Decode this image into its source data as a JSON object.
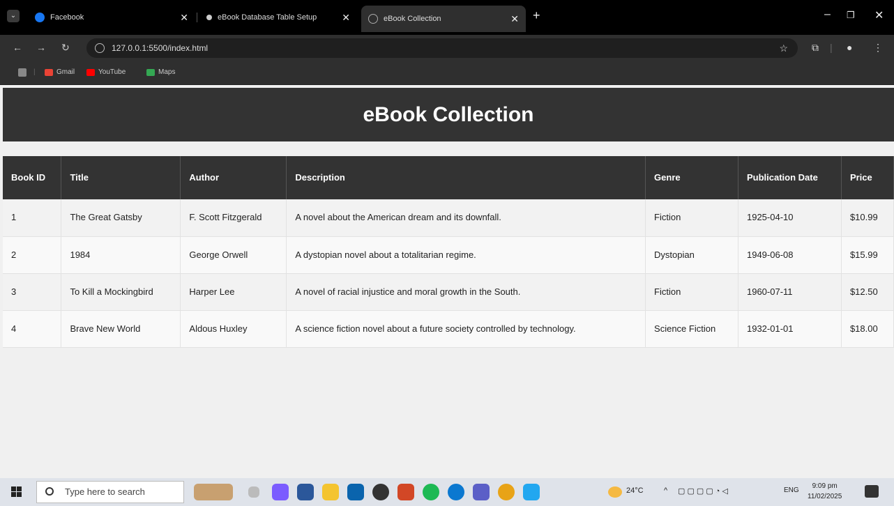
{
  "browser": {
    "tabs": [
      {
        "title": "Facebook",
        "favicon": "facebook-icon",
        "active": false
      },
      {
        "title": "eBook Database Table Setup",
        "favicon": "dot-icon",
        "active": false
      },
      {
        "title": "eBook Collection",
        "favicon": "globe-icon",
        "active": true
      }
    ],
    "url": "127.0.0.1:5500/index.html",
    "bookmarks": [
      {
        "label": "Gmail",
        "icon": "gmail-icon"
      },
      {
        "label": "YouTube",
        "icon": "youtube-icon"
      },
      {
        "label": "Maps",
        "icon": "maps-icon"
      }
    ]
  },
  "page": {
    "heading": "eBook Collection",
    "table": {
      "headers": [
        "Book ID",
        "Title",
        "Author",
        "Description",
        "Genre",
        "Publication Date",
        "Price"
      ],
      "rows": [
        [
          "1",
          "The Great Gatsby",
          "F. Scott Fitzgerald",
          "A novel about the American dream and its downfall.",
          "Fiction",
          "1925-04-10",
          "$10.99"
        ],
        [
          "2",
          "1984",
          "George Orwell",
          "A dystopian novel about a totalitarian regime.",
          "Dystopian",
          "1949-06-08",
          "$15.99"
        ],
        [
          "3",
          "To Kill a Mockingbird",
          "Harper Lee",
          "A novel of racial injustice and moral growth in the South.",
          "Fiction",
          "1960-07-11",
          "$12.50"
        ],
        [
          "4",
          "Brave New World",
          "Aldous Huxley",
          "A science fiction novel about a future society controlled by technology.",
          "Science Fiction",
          "1932-01-01",
          "$18.00"
        ]
      ]
    }
  },
  "taskbar": {
    "search_placeholder": "Type here to search",
    "weather": "24°C",
    "language": "ENG",
    "time": "9:09 pm",
    "date": "11/02/2025"
  },
  "colors": {
    "header_bg": "#333333",
    "page_bg": "#f0f0f0",
    "facebook_blue": "#1877f2",
    "youtube_red": "#ff0000"
  }
}
